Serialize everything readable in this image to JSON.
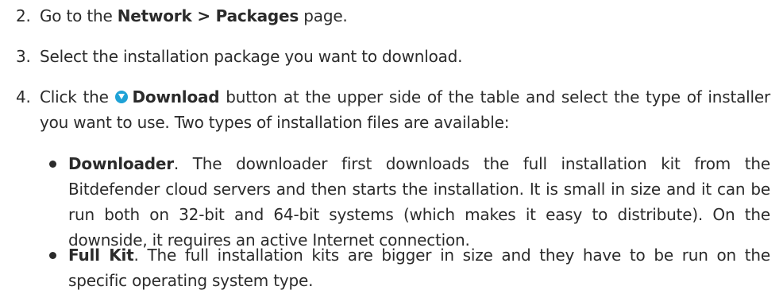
{
  "steps": [
    {
      "number": "2.",
      "before": "Go to the ",
      "bold": "Network > Packages",
      "after": " page."
    },
    {
      "number": "3.",
      "text": "Select the installation package you want to download."
    },
    {
      "number": "4.",
      "before": "Click the ",
      "icon": "download-icon",
      "bold": "Download",
      "after": " button at the upper side of the table and select the type of installer you want to use. Two types of installation files are available:"
    }
  ],
  "bullets": [
    {
      "term": "Downloader",
      "text": ". The downloader first downloads the full installation kit from the Bitdefender cloud servers and then starts the installation. It is small in size and it can be run both on 32-bit and 64-bit systems (which makes it easy to distribute). On the downside, it requires an active Internet connection."
    },
    {
      "term": "Full Kit",
      "text": ". The full installation kits are bigger in size and they have to be run on the specific operating system type."
    }
  ],
  "colors": {
    "text": "#2b2b2b",
    "icon_accent": "#1fa2d6"
  }
}
